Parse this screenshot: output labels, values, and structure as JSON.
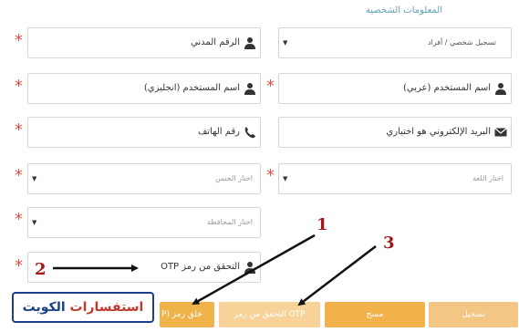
{
  "section_title": "المعلومات الشخصية",
  "fields": {
    "registration_type": "تسجيل شخصي / أفراد",
    "civil_id": "الرقم المدني",
    "username_arabic": "اسم المستخدم (عربي)",
    "username_english": "اسم المستخدم (انجليزي)",
    "email": "البريد الإلكتروني هو اختياري",
    "phone": "رقم الهاتف",
    "language_placeholder": "اختار اللغة",
    "gender_placeholder": "اختار الجنس",
    "governorate_placeholder": "اختار المحافظة",
    "otp_verify": "التحقق من رمز OTP"
  },
  "required_mark": "*",
  "buttons": {
    "otp_partial": "خلق رمز (P",
    "otp_verify": "التحقق من رمز OTP",
    "clear": "مسح",
    "last": "تسجيل"
  },
  "watermark": {
    "part1": "استفسارات ",
    "part2": "الكويت"
  },
  "annotations": {
    "n1": "1",
    "n2": "2",
    "n3": "3"
  },
  "colors": {
    "accent": "#f0b34a",
    "required": "#d9534f",
    "annotation": "#a51616",
    "brand_border": "#1b3f8a"
  },
  "icons": [
    "user-icon",
    "envelope-icon",
    "phone-icon",
    "caret-down-icon"
  ]
}
